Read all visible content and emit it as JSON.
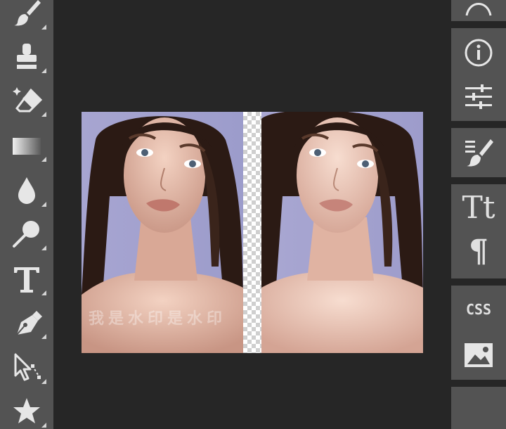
{
  "tools": [
    {
      "name": "brush-tool",
      "icon": "brush-icon"
    },
    {
      "name": "clone-stamp-tool",
      "icon": "stamp-icon"
    },
    {
      "name": "magic-eraser-tool",
      "icon": "eraser-icon"
    },
    {
      "name": "gradient-tool",
      "icon": "gradient-icon"
    },
    {
      "name": "blur-tool",
      "icon": "drop-icon"
    },
    {
      "name": "dodge-tool",
      "icon": "dodge-icon"
    },
    {
      "name": "type-tool",
      "icon": "type-icon"
    },
    {
      "name": "pen-tool",
      "icon": "pen-icon"
    },
    {
      "name": "direct-selection-tool",
      "icon": "direct-select-icon"
    },
    {
      "name": "custom-shape-tool",
      "icon": "star-icon"
    }
  ],
  "canvas": {
    "watermark_text": "我是水印是水印"
  },
  "right_panel": {
    "css_label": "CSS",
    "type_glyph": "Tt",
    "paragraph_glyph": "¶"
  },
  "colors": {
    "toolbar_bg": "#535353",
    "canvas_bg": "#262626",
    "icon_color": "#e6e6e6",
    "photo_backdrop": "#a9a6cf"
  }
}
